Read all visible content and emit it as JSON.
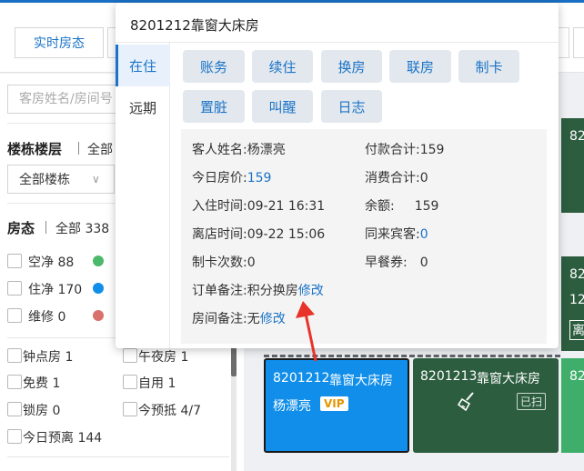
{
  "header": {
    "tabs": [
      {
        "label": "实时房态"
      }
    ]
  },
  "sidebar": {
    "search_placeholder": "客房姓名/房间号",
    "building": {
      "title": "楼栋楼层",
      "filter": "全部",
      "select_value": "全部楼栋"
    },
    "status": {
      "title": "房态",
      "filter": "全部 338"
    },
    "status_items": [
      {
        "label": "空净 88",
        "color": "#4cb86a"
      },
      {
        "label": "住净 170",
        "color": "#108ee9"
      },
      {
        "label": "维修 0",
        "color": "#d9706a"
      }
    ],
    "flags": [
      {
        "label": "钟点房 1"
      },
      {
        "label": "午夜房 1"
      },
      {
        "label": "免费 1"
      },
      {
        "label": "自用 1"
      },
      {
        "label": "锁房 0"
      },
      {
        "label": "今预抵 4/7"
      },
      {
        "label": "今日预离 144"
      }
    ]
  },
  "rooms": [
    {
      "number": "8201212",
      "type": "靠窗大床房",
      "guest": "杨漂亮",
      "badge": "VIP"
    },
    {
      "number": "8201213",
      "type": "靠窗大床房",
      "status": "已扫",
      "icon": "broom-icon"
    }
  ],
  "room_fragments": [
    "82(",
    "820",
    "12:",
    "离",
    "820"
  ],
  "popup": {
    "title": "8201212靠窗大床房",
    "side_tabs": {
      "current": "在住",
      "future": "远期"
    },
    "actions": [
      "账务",
      "续住",
      "换房",
      "联房",
      "制卡",
      "置脏",
      "叫醒",
      "日志"
    ],
    "info": {
      "guest_name_label": "客人姓名:",
      "guest_name": "杨漂亮",
      "payment_total_label": "付款合计:",
      "payment_total": "159",
      "today_rate_label": "今日房价:",
      "today_rate": "159",
      "consumption_label": "消费合计:",
      "consumption": "0",
      "checkin_label": "入住时间:",
      "checkin": "09-21 16:31",
      "balance_label": "余额:",
      "balance": "159",
      "checkout_label": "离店时间:",
      "checkout": "09-22 15:06",
      "companions_label": "同来宾客:",
      "companions": "0",
      "card_count_label": "制卡次数:",
      "card_count": "0",
      "breakfast_label": "早餐券:",
      "breakfast": "0",
      "order_remark_label": "订单备注:",
      "order_remark": "积分换房",
      "room_remark_label": "房间备注:",
      "room_remark": "无",
      "modify": "修改"
    }
  }
}
